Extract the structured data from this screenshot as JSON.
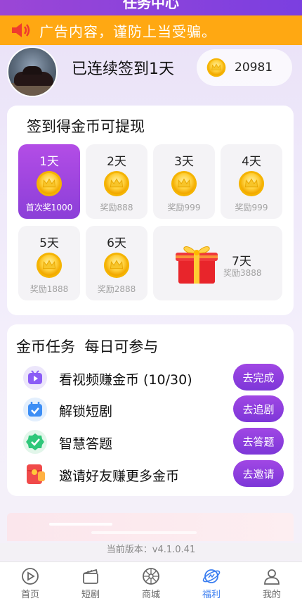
{
  "header": {
    "title": "任务中心"
  },
  "notice": {
    "text": "广告内容，谨防上当受骗。",
    "icon": "speaker-icon"
  },
  "profile": {
    "streak_text": "已连续签到1天",
    "coins": "20981"
  },
  "signin": {
    "heading": "签到得金币可提现",
    "days": [
      {
        "day": "1天",
        "reward": "首次奖1000"
      },
      {
        "day": "2天",
        "reward": "奖励888"
      },
      {
        "day": "3天",
        "reward": "奖励999"
      },
      {
        "day": "4天",
        "reward": "奖励999"
      },
      {
        "day": "5天",
        "reward": "奖励1888"
      },
      {
        "day": "6天",
        "reward": "奖励2888"
      },
      {
        "day": "7天",
        "reward": "奖励3888"
      }
    ]
  },
  "tasks": {
    "heading": "金币任务  每日可参与",
    "items": [
      {
        "label": "看视频赚金币 (10/30)",
        "button": "去完成",
        "icon": "video-icon"
      },
      {
        "label": "解锁短剧",
        "button": "去追剧",
        "icon": "calendar-icon"
      },
      {
        "label": "智慧答题",
        "button": "去答题",
        "icon": "check-badge-icon"
      },
      {
        "label": "邀请好友赚更多金币",
        "button": "去邀请",
        "icon": "red-packet-icon"
      }
    ]
  },
  "footer": {
    "version": "当前版本：v4.1.0.41"
  },
  "tabbar": {
    "items": [
      {
        "label": "首页",
        "icon": "play-icon"
      },
      {
        "label": "短剧",
        "icon": "clapperboard-icon"
      },
      {
        "label": "商城",
        "icon": "wheel-icon"
      },
      {
        "label": "福利",
        "icon": "planet-icon"
      },
      {
        "label": "我的",
        "icon": "person-icon"
      }
    ]
  },
  "colors": {
    "accent": "#9b46d6",
    "notice": "#ffa812",
    "tab_active": "#3a7df0"
  }
}
